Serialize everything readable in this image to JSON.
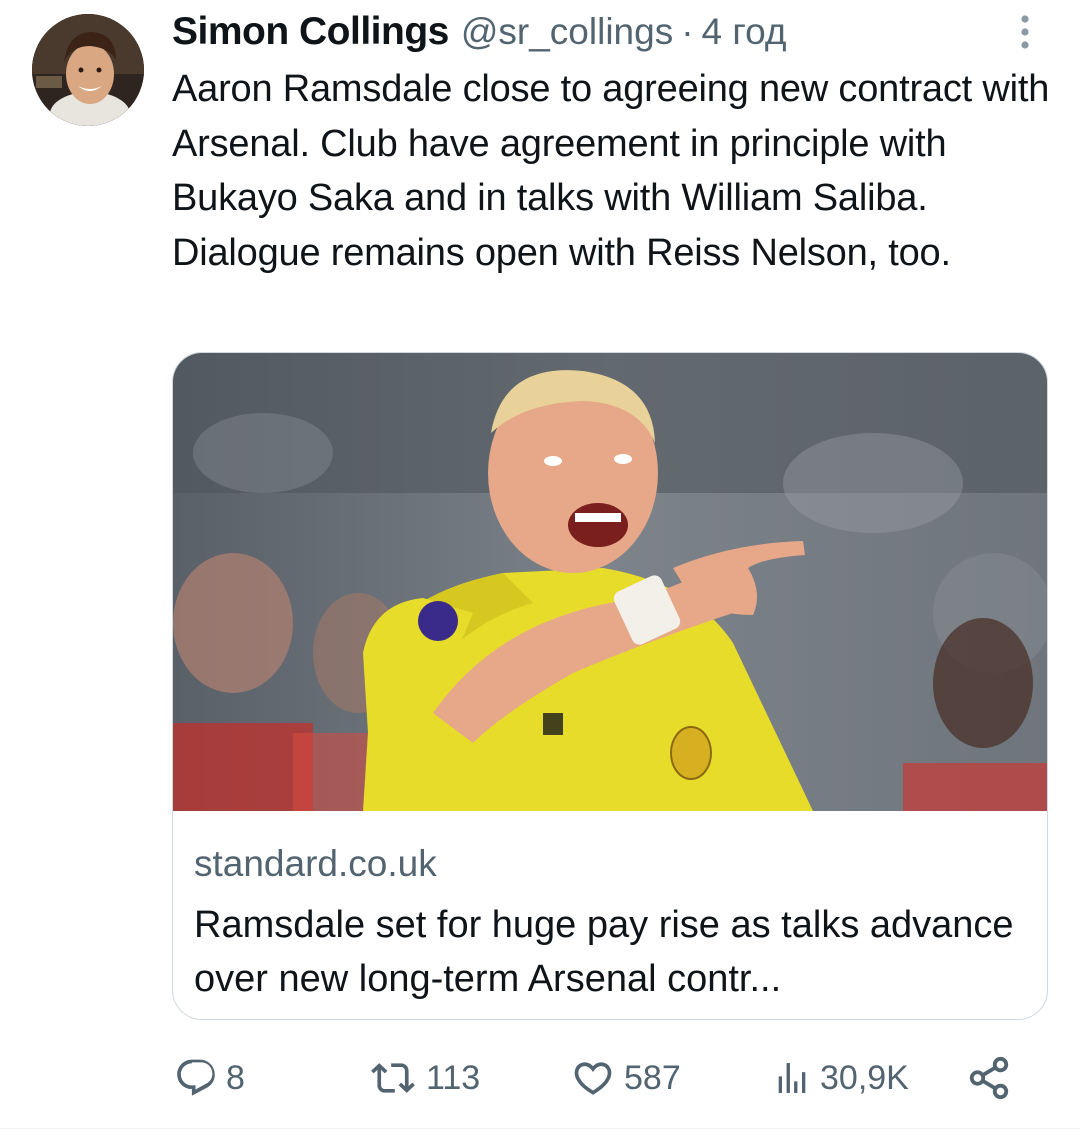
{
  "tweet": {
    "author": {
      "name": "Simon Collings",
      "handle": "@sr_collings",
      "separator": "·",
      "time": "4 год"
    },
    "text": "Aaron Ramsdale close to agreeing new contract with Arsenal. Club have agreement in principle with Bukayo Saka and in talks with William Saliba. Dialogue remains open with Reiss Nelson, too.",
    "card": {
      "domain": "standard.co.uk",
      "title": "Ramsdale set for huge pay rise as talks advance over new long-term Arsenal contr..."
    },
    "actions": {
      "replies": "8",
      "retweets": "113",
      "likes": "587",
      "views": "30,9K"
    }
  },
  "icons": {
    "more": "more-vertical-icon",
    "reply": "reply-icon",
    "retweet": "retweet-icon",
    "like": "heart-icon",
    "views": "views-icon",
    "share": "share-icon"
  },
  "colors": {
    "text_primary": "#0f1419",
    "text_secondary": "#536471",
    "border": "#cfd9de",
    "jersey_yellow": "#e8dc2a"
  }
}
